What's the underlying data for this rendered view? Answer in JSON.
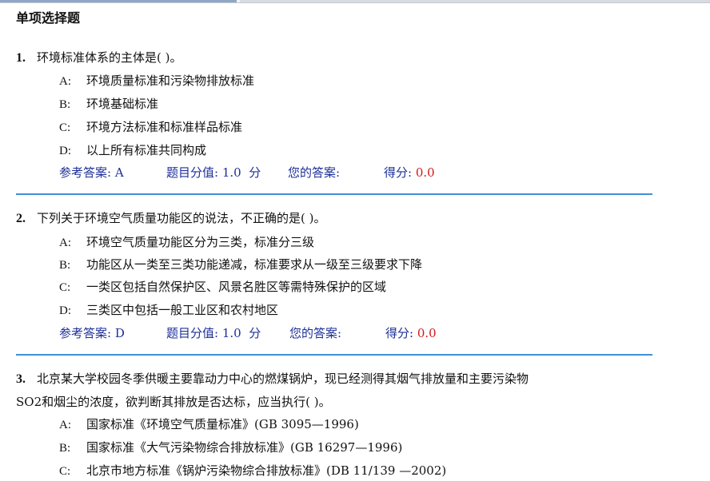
{
  "section_title": "单项选择题",
  "labels": {
    "ref_answer": "参考答案:",
    "score_value": "题目分值:",
    "score_unit": "分",
    "your_answer": "您的答案:",
    "score_got": "得分:"
  },
  "questions": [
    {
      "number": "1.",
      "stem": "环境标准体系的主体是( )。",
      "options": [
        {
          "letter": "A:",
          "text": "环境质量标准和污染物排放标准"
        },
        {
          "letter": "B:",
          "text": "环境基础标准"
        },
        {
          "letter": "C:",
          "text": "环境方法标准和标准样品标准"
        },
        {
          "letter": "D:",
          "text": "以上所有标准共同构成"
        }
      ],
      "answer": "A",
      "points": "1.0",
      "your_answer": "",
      "score": "0.0"
    },
    {
      "number": "2.",
      "stem": "下列关于环境空气质量功能区的说法，不正确的是( )。",
      "options": [
        {
          "letter": "A:",
          "text": "环境空气质量功能区分为三类，标准分三级"
        },
        {
          "letter": "B:",
          "text": "功能区从一类至三类功能递减，标准要求从一级至三级要求下降"
        },
        {
          "letter": "C:",
          "text": "一类区包括自然保护区、风景名胜区等需特殊保护的区域"
        },
        {
          "letter": "D:",
          "text": "三类区中包括一般工业区和农村地区"
        }
      ],
      "answer": "D",
      "points": "1.0",
      "your_answer": "",
      "score": "0.0"
    },
    {
      "number": "3.",
      "stem_line1": "北京某大学校园冬季供暖主要靠动力中心的燃煤锅炉，现已经测得其烟气排放量和主要污染物",
      "stem_line2": "SO2和烟尘的浓度，欲判断其排放是否达标，应当执行( )。",
      "options": [
        {
          "letter": "A:",
          "text": "国家标准《环境空气质量标准》(GB 3095—1996)"
        },
        {
          "letter": "B:",
          "text": "国家标准《大气污染物综合排放标准》(GB 16297—1996)"
        },
        {
          "letter": "C:",
          "text": "北京市地方标准《锅炉污染物综合排放标准》(DB 11/139 —2002)"
        }
      ]
    }
  ]
}
